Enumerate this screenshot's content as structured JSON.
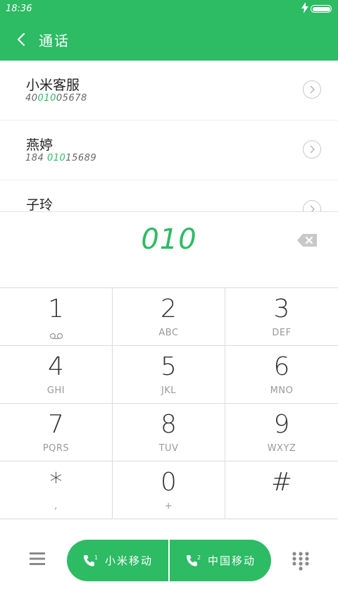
{
  "status_bar": {
    "time": "18:36",
    "battery_level": 1.0
  },
  "header": {
    "title": "通话"
  },
  "contacts": [
    {
      "name": "小米客服",
      "number_pre": "40",
      "number_match": "010",
      "number_post": "05678"
    },
    {
      "name": "燕婷",
      "number_pre": "184 ",
      "number_match": "010",
      "number_post": "15689"
    },
    {
      "name": "子玲",
      "number_pre": "",
      "number_match": "",
      "number_post": ""
    }
  ],
  "input": {
    "digits": "010"
  },
  "keypad": {
    "keys": [
      {
        "digit": "1",
        "letters": ""
      },
      {
        "digit": "2",
        "letters": "ABC"
      },
      {
        "digit": "3",
        "letters": "DEF"
      },
      {
        "digit": "4",
        "letters": "GHI"
      },
      {
        "digit": "5",
        "letters": "JKL"
      },
      {
        "digit": "6",
        "letters": "MNO"
      },
      {
        "digit": "7",
        "letters": "PQRS"
      },
      {
        "digit": "8",
        "letters": "TUV"
      },
      {
        "digit": "9",
        "letters": "WXYZ"
      },
      {
        "digit": "*",
        "letters": ","
      },
      {
        "digit": "0",
        "letters": "+"
      },
      {
        "digit": "#",
        "letters": ""
      }
    ]
  },
  "call_buttons": [
    {
      "sim": "1",
      "label": "小米移动"
    },
    {
      "sim": "2",
      "label": "中国移动"
    }
  ],
  "colors": {
    "accent": "#2dbb64"
  },
  "icons": [
    "back-arrow-icon",
    "lightning-icon",
    "battery-icon",
    "chevron-right-icon",
    "backspace-icon",
    "voicemail-icon",
    "menu-icon",
    "phone-sim1-icon",
    "phone-sim2-icon",
    "dialpad-grid-icon"
  ]
}
